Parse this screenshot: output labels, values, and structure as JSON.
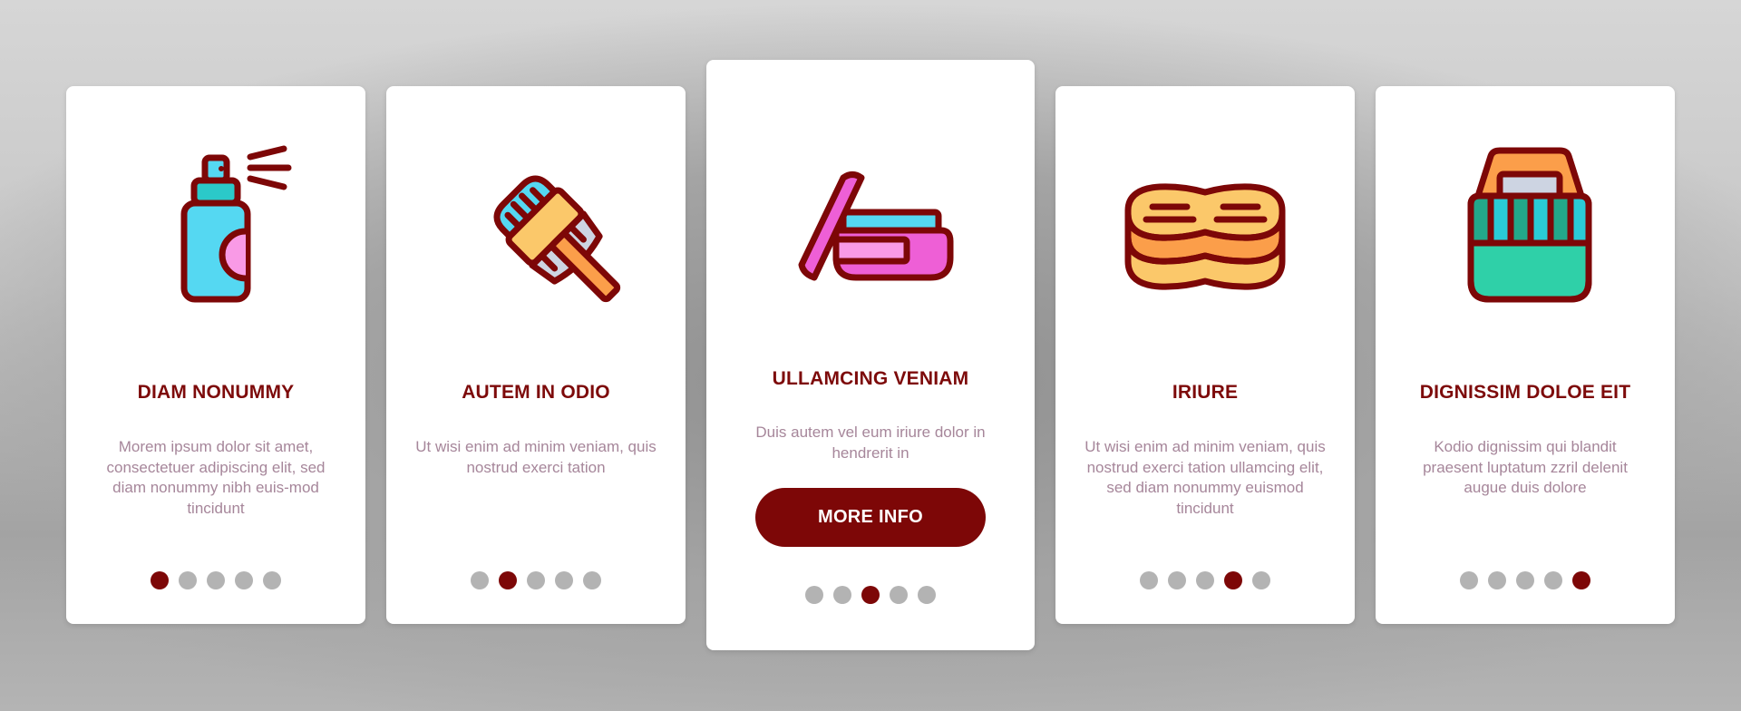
{
  "colors": {
    "accent": "#7d0707",
    "title": "#7d0a0a",
    "description": "#a6869a",
    "dot_inactive": "#b3b3b3",
    "card": "#ffffff"
  },
  "cards": [
    {
      "icon": "spray-bottle-icon",
      "title": "DIAM NONUMMY",
      "description": "Morem ipsum dolor sit amet, consectetuer adipiscing elit, sed diam nonummy nibh euis-mod tincidunt",
      "active_page": 1,
      "page_count": 5
    },
    {
      "icon": "hair-brush-icon",
      "title": "AUTEM IN ODIO",
      "description": "Ut wisi enim ad minim veniam, quis nostrud exerci tation",
      "active_page": 2,
      "page_count": 5
    },
    {
      "icon": "cream-jar-icon",
      "title": "ULLAMCING VENIAM",
      "description": "Duis autem vel eum iriure dolor in hendrerit in",
      "button_label": "MORE INFO",
      "active_page": 3,
      "page_count": 5
    },
    {
      "icon": "sponge-icon",
      "title": "IRIURE",
      "description": "Ut wisi enim ad minim veniam, quis nostrud exerci tation ullamcing elit, sed diam nonummy euismod tincidunt",
      "active_page": 4,
      "page_count": 5
    },
    {
      "icon": "basket-icon",
      "title": "DIGNISSIM DOLOE EIT",
      "description": "Kodio dignissim qui blandit praesent luptatum zzril delenit augue duis dolore",
      "active_page": 5,
      "page_count": 5
    }
  ]
}
